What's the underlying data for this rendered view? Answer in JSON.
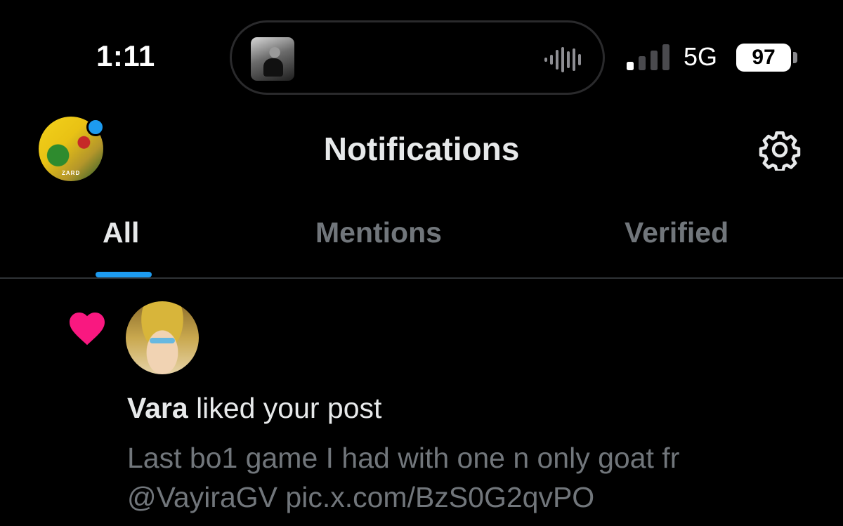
{
  "status_bar": {
    "time": "1:11",
    "network": "5G",
    "battery": "97",
    "icons": [
      "now-playing-art",
      "waveform-icon",
      "signal-bars-icon",
      "battery-icon"
    ]
  },
  "header": {
    "title": "Notifications",
    "icons": [
      "profile-avatar",
      "gear-icon"
    ],
    "accent_color": "#1d9bf0"
  },
  "tabs": [
    {
      "label": "All",
      "selected": true
    },
    {
      "label": "Mentions",
      "selected": false
    },
    {
      "label": "Verified",
      "selected": false
    }
  ],
  "notification": {
    "type_icon": "heart-icon",
    "type_color": "#f91880",
    "user": "Vara",
    "action": "liked your post",
    "post_line_1": "Last bo1 game I had with one n only goat fr",
    "post_line_2": "@VayiraGV pic.x.com/BzS0G2qvPO"
  }
}
